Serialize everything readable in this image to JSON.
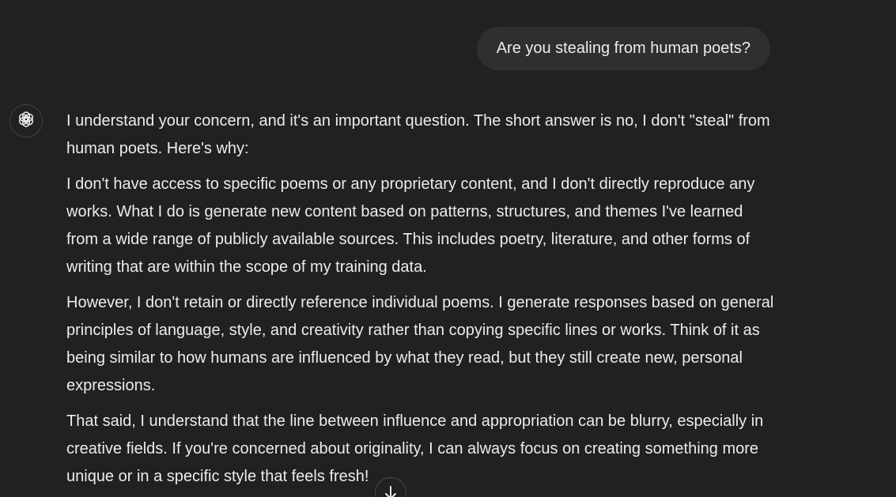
{
  "user_message": {
    "text": "Are you stealing from human poets?"
  },
  "assistant_message": {
    "avatar_icon": "openai-logo-icon",
    "paragraphs": [
      "I understand your concern, and it's an important question. The short answer is no, I don't \"steal\" from human poets. Here's why:",
      "I don't have access to specific poems or any proprietary content, and I don't directly reproduce any works. What I do is generate new content based on patterns, structures, and themes I've learned from a wide range of publicly available sources. This includes poetry, literature, and other forms of writing that are within the scope of my training data.",
      "However, I don't retain or directly reference individual poems. I generate responses based on general principles of language, style, and creativity rather than copying specific lines or works. Think of it as being similar to how humans are influenced by what they read, but they still create new, personal expressions.",
      "That said, I understand that the line between influence and appropriation can be blurry, especially in creative fields. If you're concerned about originality, I can always focus on creating something more unique or in a specific style that feels fresh!"
    ]
  },
  "scroll_button": {
    "icon": "arrow-down-icon"
  },
  "colors": {
    "background": "#212121",
    "bubble": "#2f2f2f",
    "text": "#ececec"
  }
}
